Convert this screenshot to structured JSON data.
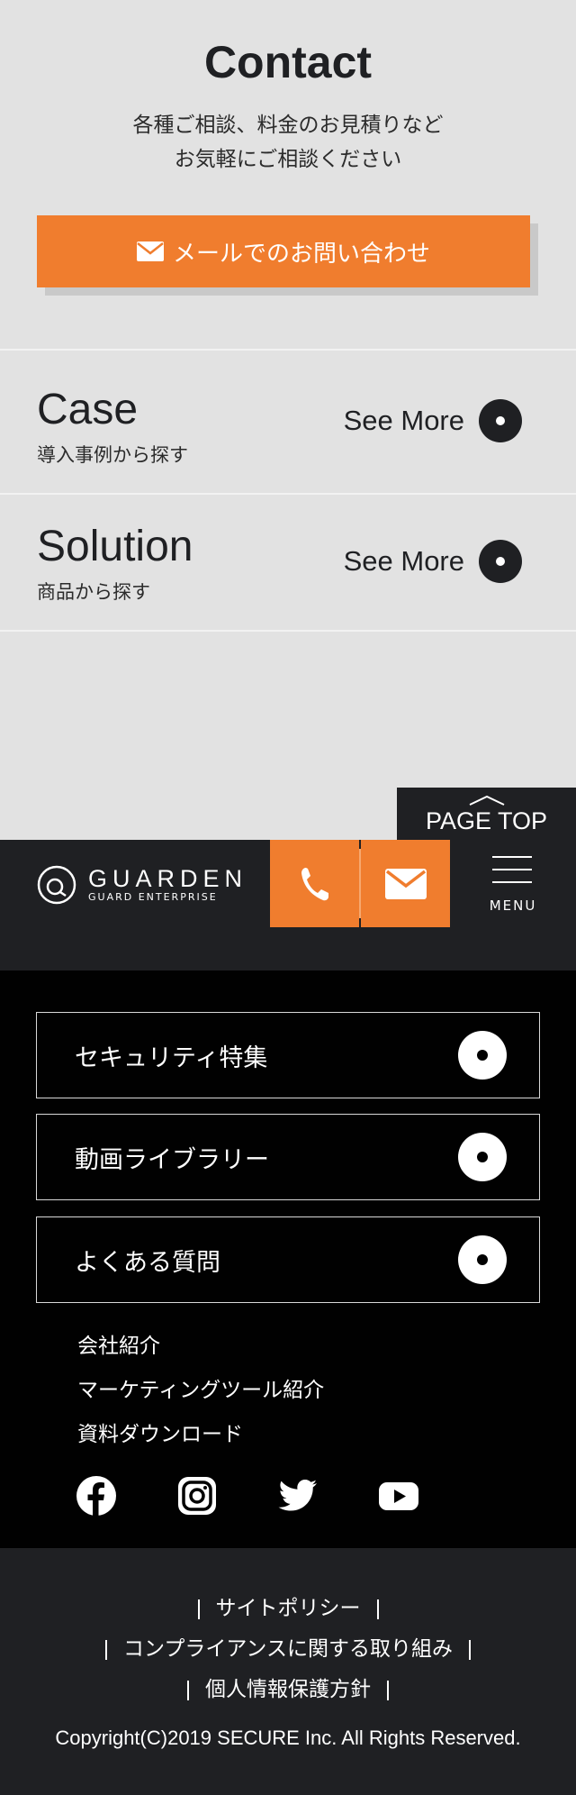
{
  "contact": {
    "title": "Contact",
    "lead_line1": "各種ご相談、料金のお見積りなど",
    "lead_line2": "お気軽にご相談ください",
    "button_label": "メールでのお問い合わせ"
  },
  "case": {
    "title": "Case",
    "sub": "導入事例から探す",
    "see_more": "See More"
  },
  "solution": {
    "title": "Solution",
    "sub": "商品から探す",
    "see_more": "See More"
  },
  "page_top": "PAGE TOP",
  "header": {
    "logo_name": "GUARDEN",
    "logo_sub": "GUARD ENTERPRISE",
    "menu_label": "MENU"
  },
  "footer_nav": {
    "boxes": [
      "セキュリティ特集",
      "動画ライブラリー",
      "よくある質問"
    ],
    "links": [
      "会社紹介",
      "マーケティングツール紹介",
      "資料ダウンロード"
    ],
    "social": [
      "facebook-icon",
      "instagram-icon",
      "twitter-icon",
      "youtube-icon"
    ]
  },
  "footer_bottom": {
    "policies": [
      "サイトポリシー",
      "コンプライアンスに関する取り組み",
      "個人情報保護方針"
    ],
    "copyright": "Copyright(C)2019 SECURE Inc. All Rights Reserved."
  },
  "colors": {
    "accent": "#f07d2e",
    "dark": "#1f2023",
    "black": "#010101",
    "light_bg": "#e2e2e2"
  }
}
